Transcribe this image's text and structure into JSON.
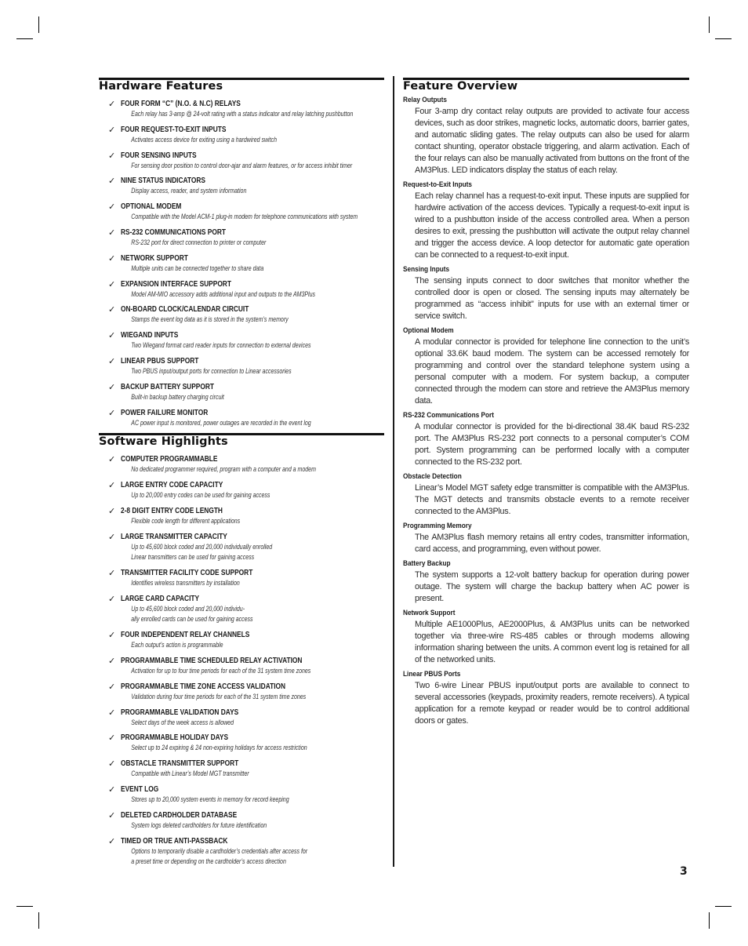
{
  "hardware_features": {
    "heading": "Hardware Features",
    "check_glyph": "✓",
    "items": [
      {
        "title": "FOUR FORM “C” (N.O. & N.C) RELAYS",
        "desc": [
          "Each relay has 3-amp @ 24-volt rating with a status indicator and relay latching pushbutton"
        ]
      },
      {
        "title": "FOUR REQUEST-TO-EXIT INPUTS",
        "desc": [
          "Activates access device for exiting using a hardwired switch"
        ]
      },
      {
        "title": "FOUR SENSING INPUTS",
        "desc": [
          "For sensing door position to control door-ajar and alarm features, or for access inhibit timer"
        ]
      },
      {
        "title": "NINE STATUS INDICATORS",
        "desc": [
          "Display access, reader, and system information"
        ]
      },
      {
        "title": "OPTIONAL MODEM",
        "desc": [
          "Compatible with the Model ACM-1 plug-in modem for telephone communications with system"
        ]
      },
      {
        "title": "RS-232 COMMUNICATIONS PORT",
        "desc": [
          "RS-232 port for direct connection to printer or computer"
        ]
      },
      {
        "title": "NETWORK SUPPORT",
        "desc": [
          "Multiple units can be connected together to share data"
        ]
      },
      {
        "title": "EXPANSION INTERFACE SUPPORT",
        "desc": [
          "Model AM-MIO accessory adds additional input and outputs to the AM3Plus"
        ]
      },
      {
        "title": "ON-BOARD CLOCK/CALENDAR CIRCUIT",
        "desc": [
          "Stamps the event log data as it is stored in the system’s memory"
        ]
      },
      {
        "title": "WIEGAND INPUTS",
        "desc": [
          "Two Wiegand format card reader inputs for connection to external devices"
        ]
      },
      {
        "title": "LINEAR PBUS SUPPORT",
        "desc": [
          "Two PBUS input/output ports for connection to Linear accessories"
        ]
      },
      {
        "title": "BACKUP BATTERY SUPPORT",
        "desc": [
          "Built-in backup battery charging circuit"
        ]
      },
      {
        "title": "POWER FAILURE MONITOR",
        "desc": [
          "AC power input is monitored, power outages are recorded in the event log"
        ]
      }
    ]
  },
  "software_highlights": {
    "heading": "Software Highlights",
    "check_glyph": "✓",
    "items": [
      {
        "title": "COMPUTER PROGRAMMABLE",
        "desc": [
          "No dedicated programmer required, program with a computer and a modem"
        ]
      },
      {
        "title": "LARGE ENTRY CODE CAPACITY",
        "desc": [
          "Up to 20,000 entry codes can be used for gaining access"
        ]
      },
      {
        "title": "2-8 DIGIT ENTRY CODE LENGTH",
        "desc": [
          "Flexible code length for different applications"
        ]
      },
      {
        "title": "LARGE TRANSMITTER CAPACITY",
        "desc": [
          "Up to 45,600 block coded and 20,000 individually enrolled",
          "Linear transmitters can be used for gaining access"
        ]
      },
      {
        "title": "TRANSMITTER FACILITY CODE SUPPORT",
        "desc": [
          "Identifies wireless transmitters by installation"
        ]
      },
      {
        "title": "LARGE CARD CAPACITY",
        "desc": [
          "Up to 45,600 block coded and 20,000 individu-",
          "ally enrolled cards can be used for gaining access"
        ]
      },
      {
        "title": "FOUR INDEPENDENT RELAY CHANNELS",
        "desc": [
          "Each output’s action is programmable"
        ]
      },
      {
        "title": "PROGRAMMABLE TIME SCHEDULED RELAY ACTIVATION",
        "desc": [
          "Activation for up to four time periods for each of the 31 system time zones"
        ]
      },
      {
        "title": "PROGRAMMABLE TIME ZONE ACCESS VALIDATION",
        "desc": [
          "Validation during four time periods for each of the 31 system time zones"
        ]
      },
      {
        "title": "PROGRAMMABLE VALIDATION DAYS",
        "desc": [
          "Select days of the week access is allowed"
        ]
      },
      {
        "title": "PROGRAMMABLE HOLIDAY DAYS",
        "desc": [
          "Select up to 24 expiring & 24 non-expiring holidays for access restriction"
        ]
      },
      {
        "title": "OBSTACLE TRANSMITTER SUPPORT",
        "desc": [
          "Compatible with Linear’s Model MGT transmitter"
        ]
      },
      {
        "title": "EVENT LOG",
        "desc": [
          "Stores up to 20,000 system events in memory for record keeping"
        ]
      },
      {
        "title": "DELETED CARDHOLDER DATABASE",
        "desc": [
          "System logs deleted cardholders for future identification"
        ]
      },
      {
        "title": "TIMED OR TRUE ANTI-PASSBACK",
        "desc": [
          "Options to temporarily disable a cardholder’s credentials after access for",
          "a preset time or depending on the cardholder’s access direction"
        ]
      }
    ]
  },
  "feature_overview": {
    "heading": "Feature Overview",
    "sections": [
      {
        "title": "Relay Outputs",
        "body": "Four 3-amp dry contact relay outputs are provided to activate four access devices, such as door strikes, magnetic locks, automatic doors, barrier gates, and automatic sliding gates. The relay outputs can also be used for alarm contact shunting, operator obstacle triggering, and alarm activation. Each of the four relays can also be manually activated from buttons on the front of the AM3Plus. LED indicators display the status of each relay."
      },
      {
        "title": "Request-to-Exit Inputs",
        "body": "Each relay channel has a request-to-exit input. These inputs are supplied for hardwire activation of the access devices. Typically a request-to-exit input is wired to a pushbutton inside of the access controlled area. When a person desires to exit, pressing the pushbutton will activate the output relay channel and trigger the access device. A loop detector for automatic gate operation can be connected to a request-to-exit input."
      },
      {
        "title": "Sensing Inputs",
        "body": "The sensing inputs connect to door switches that monitor whether the controlled door is open or closed. The sensing inputs may alternately be programmed as “access inhibit” inputs for use with an external timer or service switch."
      },
      {
        "title": "Optional Modem",
        "body": "A modular connector is provided for telephone line connection to the unit’s optional 33.6K baud modem. The system can be accessed remotely for programming and control over the standard telephone system using a personal computer with a modem. For system backup, a computer connected through the modem can store and retrieve the AM3Plus memory data."
      },
      {
        "title": "RS-232 Communications Port",
        "body": "A modular connector is provided for the bi-directional 38.4K baud RS-232 port. The AM3Plus RS-232 port connects to a personal computer’s COM port. System programming can be performed locally with a computer connected to the RS-232 port."
      },
      {
        "title": "Obstacle Detection",
        "body": "Linear’s Model MGT safety edge transmitter is compatible with the AM3Plus. The MGT detects and transmits obstacle events to a remote receiver connected to the AM3Plus."
      },
      {
        "title": "Programming Memory",
        "body": "The AM3Plus flash memory retains all entry codes, transmitter information, card access, and programming, even without power."
      },
      {
        "title": "Battery Backup",
        "body": "The system supports a 12-volt battery backup for operation during power outage. The system will charge the backup battery when AC power is present."
      },
      {
        "title": "Network Support",
        "body": "Multiple AE1000Plus, AE2000Plus, & AM3Plus units can be networked together via three-wire RS-485 cables or through modems allowing information sharing between the units. A common event log is retained for all of the networked units."
      },
      {
        "title": "Linear PBUS Ports",
        "body": "Two 6-wire Linear PBUS input/output ports are available to connect to several accessories (keypads, proximity readers, remote receivers). A typical application for a remote keypad or reader would be to control additional doors or gates."
      }
    ]
  },
  "page_number": "3"
}
